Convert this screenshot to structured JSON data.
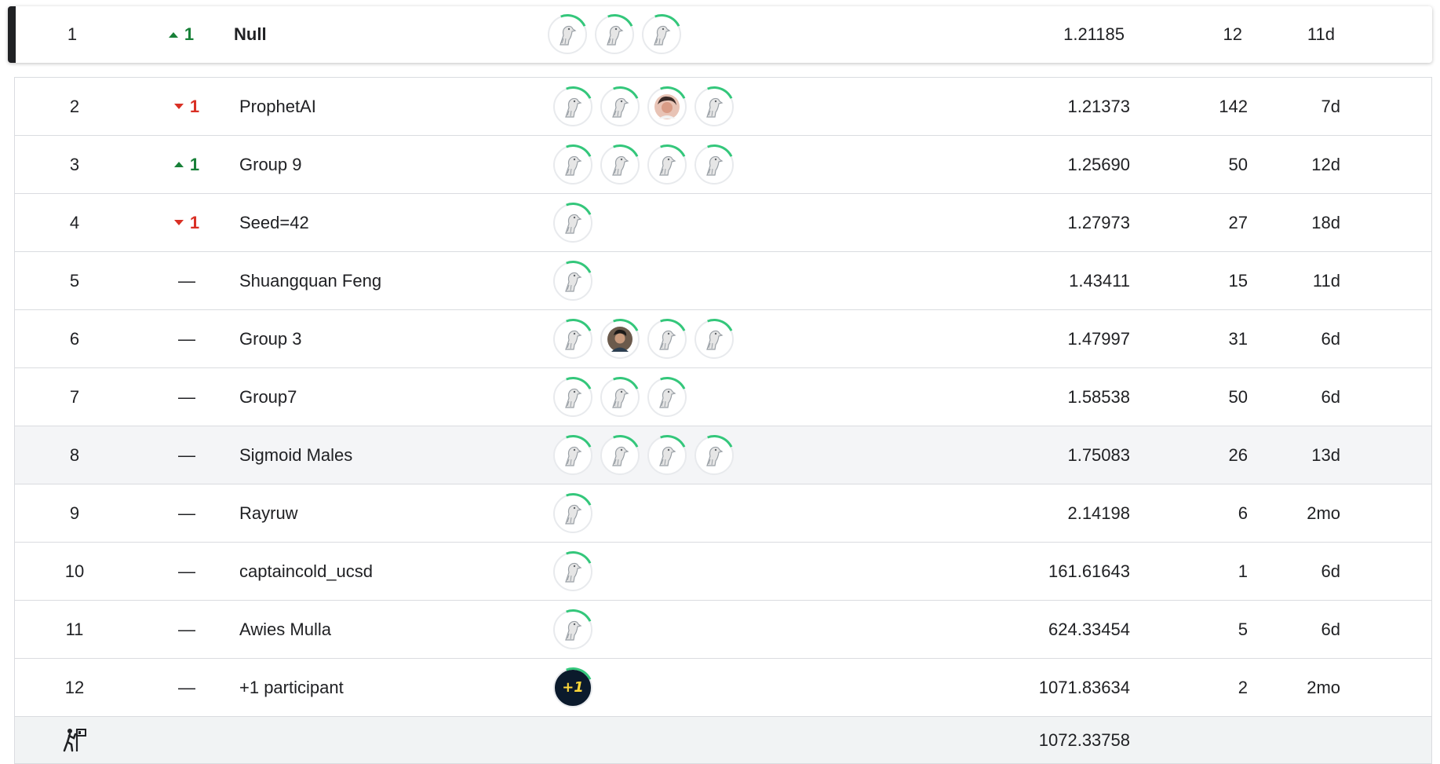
{
  "top_row": {
    "rank": "1",
    "delta": "1",
    "direction": "up",
    "name": "Null",
    "avatars": [
      "goose-icon",
      "goose-icon",
      "goose-icon"
    ],
    "score": "1.21185",
    "entries": "12",
    "last": "11d"
  },
  "rows": [
    {
      "rank": "2",
      "delta": "1",
      "direction": "down",
      "name": "ProphetAI",
      "avatars": [
        "goose-icon",
        "goose-icon",
        "photo-avatar-woman",
        "goose-icon"
      ],
      "score": "1.21373",
      "entries": "142",
      "last": "7d"
    },
    {
      "rank": "3",
      "delta": "1",
      "direction": "up",
      "name": "Group 9",
      "avatars": [
        "goose-icon",
        "goose-icon",
        "goose-icon",
        "goose-icon"
      ],
      "score": "1.25690",
      "entries": "50",
      "last": "12d"
    },
    {
      "rank": "4",
      "delta": "1",
      "direction": "down",
      "name": "Seed=42",
      "avatars": [
        "goose-icon"
      ],
      "score": "1.27973",
      "entries": "27",
      "last": "18d"
    },
    {
      "rank": "5",
      "delta": "—",
      "direction": "none",
      "name": "Shuangquan Feng",
      "avatars": [
        "goose-icon"
      ],
      "score": "1.43411",
      "entries": "15",
      "last": "11d"
    },
    {
      "rank": "6",
      "delta": "—",
      "direction": "none",
      "name": "Group 3",
      "avatars": [
        "goose-icon",
        "photo-avatar-man",
        "goose-icon",
        "goose-icon"
      ],
      "score": "1.47997",
      "entries": "31",
      "last": "6d"
    },
    {
      "rank": "7",
      "delta": "—",
      "direction": "none",
      "name": "Group7",
      "avatars": [
        "goose-icon",
        "goose-icon",
        "goose-icon"
      ],
      "score": "1.58538",
      "entries": "50",
      "last": "6d"
    },
    {
      "rank": "8",
      "delta": "—",
      "direction": "none",
      "name": "Sigmoid Males",
      "avatars": [
        "goose-icon",
        "goose-icon",
        "goose-icon",
        "goose-icon"
      ],
      "score": "1.75083",
      "entries": "26",
      "last": "13d",
      "highlight": true
    },
    {
      "rank": "9",
      "delta": "—",
      "direction": "none",
      "name": "Rayruw",
      "avatars": [
        "goose-icon"
      ],
      "score": "2.14198",
      "entries": "6",
      "last": "2mo"
    },
    {
      "rank": "10",
      "delta": "—",
      "direction": "none",
      "name": "captaincold_ucsd",
      "avatars": [
        "goose-icon"
      ],
      "score": "161.61643",
      "entries": "1",
      "last": "6d"
    },
    {
      "rank": "11",
      "delta": "—",
      "direction": "none",
      "name": "Awies Mulla",
      "avatars": [
        "goose-icon"
      ],
      "score": "624.33454",
      "entries": "5",
      "last": "6d"
    },
    {
      "rank": "12",
      "delta": "—",
      "direction": "none",
      "name": "+1 participant",
      "avatars": [
        "plus-one-badge"
      ],
      "score": "1071.83634",
      "entries": "2",
      "last": "2mo"
    }
  ],
  "footer": {
    "icon": "benchmark-person-icon",
    "score": "1072.33758"
  },
  "colors": {
    "up": "#188038",
    "down": "#d93025",
    "ring": "#34c77b",
    "border": "#dadce0",
    "highlight": "#f4f5f7"
  },
  "badge_text": "+1"
}
